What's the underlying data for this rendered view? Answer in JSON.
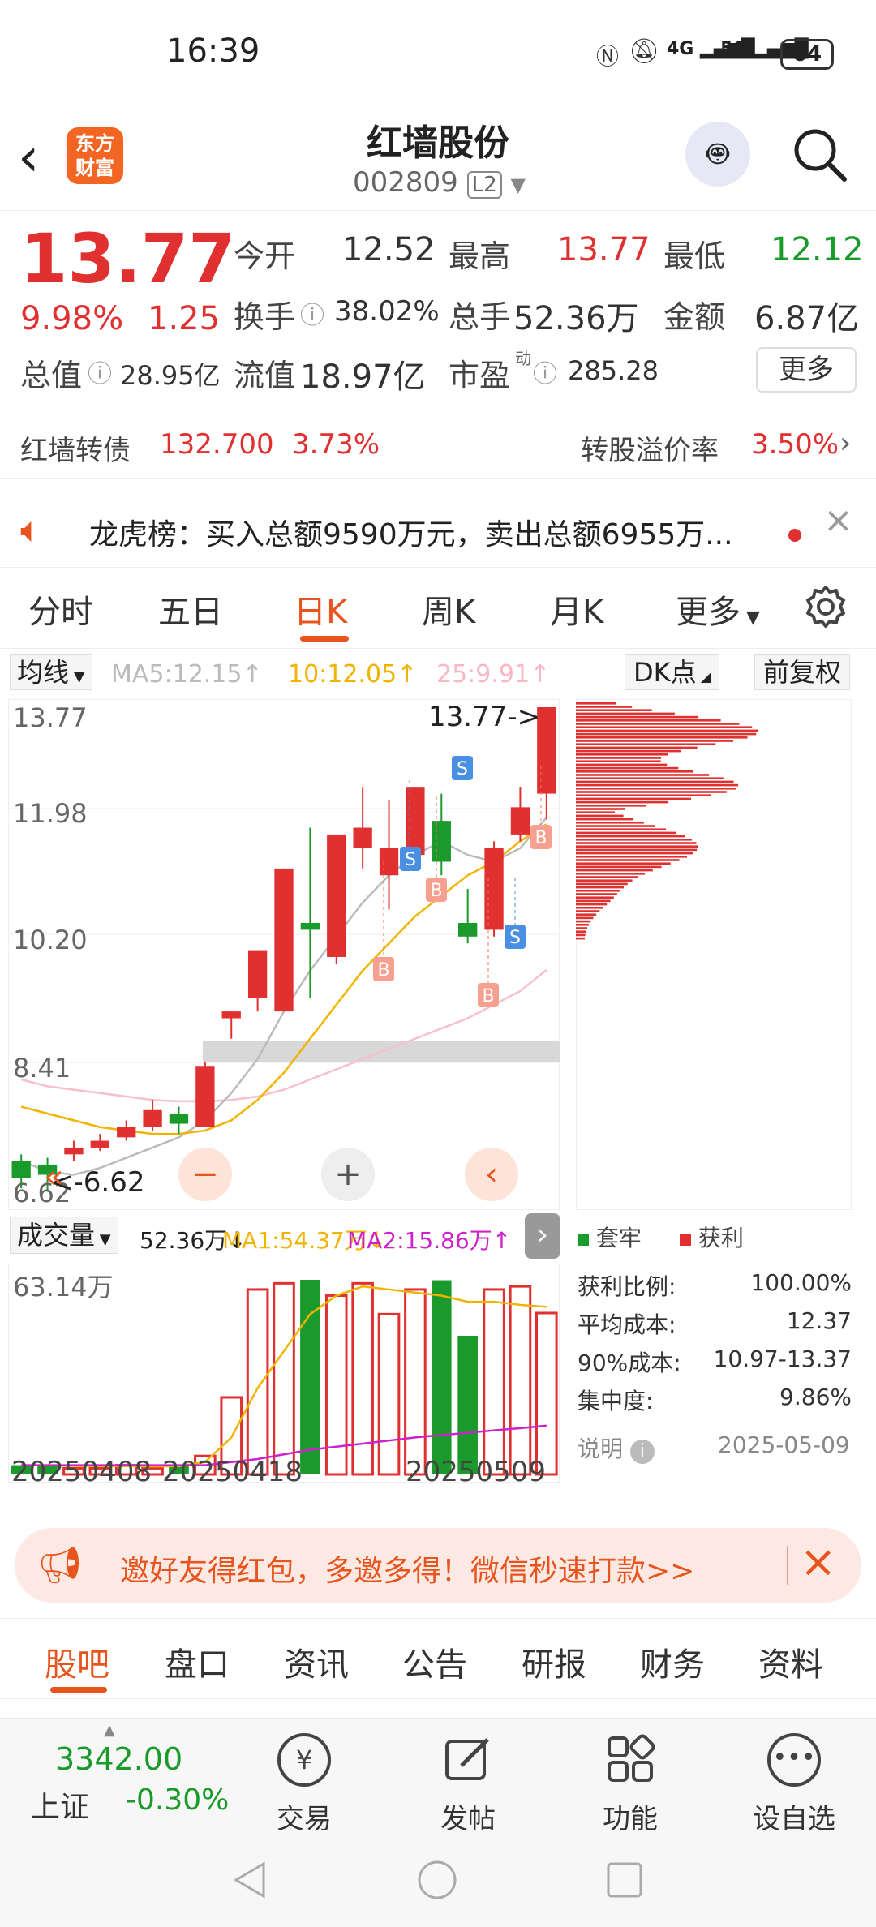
{
  "status": {
    "time": "16:39",
    "battery": "64",
    "signal1": "4G",
    "signal2": "5G"
  },
  "nav": {
    "logo_line1": "东方",
    "logo_line2": "财富",
    "title": "红墙股份",
    "code": "002809",
    "level": "L2"
  },
  "quote": {
    "price": "13.77",
    "pct": "9.98%",
    "change": "1.25",
    "open_label": "今开",
    "open": "12.52",
    "high_label": "最高",
    "high": "13.77",
    "low_label": "最低",
    "low": "12.12",
    "turnover_label": "换手",
    "turnover": "38.02%",
    "volume_label": "总手",
    "volume": "52.36万",
    "amount_label": "金额",
    "amount": "6.87亿",
    "mktcap_label": "总值",
    "mktcap": "28.95亿",
    "float_label": "流值",
    "float": "18.97亿",
    "pe_label": "市盈",
    "pe_sup": "动",
    "pe": "285.28",
    "more_button": "更多",
    "bond_label": "红墙转债",
    "bond_price": "132.700",
    "bond_pct": "3.73%",
    "premium_label": "转股溢价率",
    "premium": "3.50%"
  },
  "notice": {
    "text": "龙虎榜：买入总额9590万元，卖出总额6955万..."
  },
  "ktabs": [
    "分时",
    "五日",
    "日K",
    "周K",
    "月K",
    "更多"
  ],
  "ktab_active": 2,
  "chart_header": {
    "ma_button": "均线",
    "ma5": "MA5:12.15↑",
    "ma10": "10:12.05↑",
    "ma25": "25:9.91↑",
    "dk_button": "DK点",
    "adjust_button": "前复权"
  },
  "price_axis": [
    "13.77",
    "11.98",
    "10.20",
    "8.41",
    "6.62"
  ],
  "annotations": {
    "high": "13.77->",
    "low": "<-6.62"
  },
  "volume_header": {
    "button": "成交量",
    "vol": "52.36万↓",
    "ma1": "MA1:54.37万↓",
    "ma2": "MA2:15.86万↑",
    "max": "63.14万"
  },
  "dates": [
    "20250408",
    "20250418",
    "20250509"
  ],
  "legend": {
    "trapped": "套牢",
    "profit": "获利"
  },
  "chip_stats": [
    {
      "label": "获利比例:",
      "value": "100.00%"
    },
    {
      "label": "平均成本:",
      "value": "12.37"
    },
    {
      "label": "90%成本:",
      "value": "10.97-13.37"
    },
    {
      "label": "集中度:",
      "value": "9.86%"
    }
  ],
  "chip_note": {
    "label": "说明",
    "date": "2025-05-09"
  },
  "promo": {
    "text": "邀好友得红包，多邀多得！微信秒速打款>>"
  },
  "subtabs": [
    "股吧",
    "盘口",
    "资讯",
    "公告",
    "研报",
    "财务",
    "资料"
  ],
  "index": {
    "value": "3342.00",
    "name": "上证",
    "pct": "-0.30%"
  },
  "bottom_items": [
    "交易",
    "发帖",
    "功能",
    "设自选"
  ],
  "colors": {
    "up": "#e03030",
    "down": "#1a9a2a",
    "accent": "#e8541e"
  },
  "chart_data": {
    "type": "candlestick",
    "y_range": [
      6.62,
      13.77
    ],
    "candles": [
      {
        "o": 7.1,
        "c": 6.85,
        "h": 7.2,
        "l": 6.7
      },
      {
        "o": 7.05,
        "c": 6.9,
        "h": 7.15,
        "l": 6.65
      },
      {
        "o": 7.2,
        "c": 7.3,
        "h": 7.4,
        "l": 7.1
      },
      {
        "o": 7.3,
        "c": 7.4,
        "h": 7.5,
        "l": 7.25
      },
      {
        "o": 7.45,
        "c": 7.6,
        "h": 7.7,
        "l": 7.4
      },
      {
        "o": 7.6,
        "c": 7.85,
        "h": 8.0,
        "l": 7.55
      },
      {
        "o": 7.8,
        "c": 7.65,
        "h": 7.9,
        "l": 7.5
      },
      {
        "o": 7.6,
        "c": 8.5,
        "h": 8.55,
        "l": 7.6
      },
      {
        "o": 9.2,
        "c": 9.3,
        "h": 9.3,
        "l": 8.9
      },
      {
        "o": 9.5,
        "c": 10.2,
        "h": 10.2,
        "l": 9.3
      },
      {
        "o": 9.3,
        "c": 11.4,
        "h": 11.4,
        "l": 9.3
      },
      {
        "o": 10.6,
        "c": 10.5,
        "h": 12.0,
        "l": 9.5
      },
      {
        "o": 10.1,
        "c": 11.9,
        "h": 11.9,
        "l": 10.0
      },
      {
        "o": 11.7,
        "c": 12.0,
        "h": 12.6,
        "l": 11.4
      },
      {
        "o": 11.3,
        "c": 11.7,
        "h": 12.4,
        "l": 10.8
      },
      {
        "o": 11.6,
        "c": 12.6,
        "h": 12.6,
        "l": 11.5
      },
      {
        "o": 12.1,
        "c": 11.5,
        "h": 12.5,
        "l": 11.3
      },
      {
        "o": 10.6,
        "c": 10.4,
        "h": 11.1,
        "l": 10.3
      },
      {
        "o": 10.5,
        "c": 11.7,
        "h": 11.8,
        "l": 10.4
      },
      {
        "o": 11.9,
        "c": 12.3,
        "h": 12.6,
        "l": 11.8
      },
      {
        "o": 12.5,
        "c": 13.77,
        "h": 13.77,
        "l": 12.12
      }
    ],
    "ma5": [
      7.1,
      6.95,
      6.9,
      7.0,
      7.15,
      7.3,
      7.45,
      7.7,
      8.1,
      8.6,
      9.3,
      9.9,
      10.4,
      10.9,
      11.3,
      11.6,
      11.8,
      11.6,
      11.5,
      11.7,
      12.15
    ],
    "ma10": [
      7.9,
      7.8,
      7.7,
      7.6,
      7.55,
      7.5,
      7.5,
      7.55,
      7.7,
      8.0,
      8.4,
      8.9,
      9.4,
      9.9,
      10.3,
      10.7,
      11.0,
      11.3,
      11.5,
      11.8,
      12.05
    ],
    "ma25": [
      8.3,
      8.2,
      8.15,
      8.1,
      8.05,
      8.0,
      7.98,
      7.98,
      8.0,
      8.05,
      8.15,
      8.3,
      8.45,
      8.6,
      8.75,
      8.9,
      9.05,
      9.2,
      9.4,
      9.6,
      9.91
    ],
    "volume": [
      3,
      3,
      2,
      2,
      3,
      2,
      3,
      6,
      25,
      60,
      62,
      63.14,
      58,
      62,
      52,
      60,
      63,
      45,
      60,
      61,
      52.36
    ],
    "volume_max": 63.14,
    "vol_ma1": [
      3,
      3,
      2.8,
      2.7,
      2.7,
      2.6,
      2.7,
      4,
      12,
      28,
      40,
      52,
      58,
      61,
      60,
      59,
      58,
      56,
      56,
      55,
      54.37
    ],
    "vol_ma2": [
      3,
      3,
      3,
      3,
      3,
      3,
      3,
      3,
      4,
      5,
      6.5,
      8,
      9,
      10,
      11,
      12,
      12.8,
      13.5,
      14.3,
      15,
      15.86
    ]
  }
}
